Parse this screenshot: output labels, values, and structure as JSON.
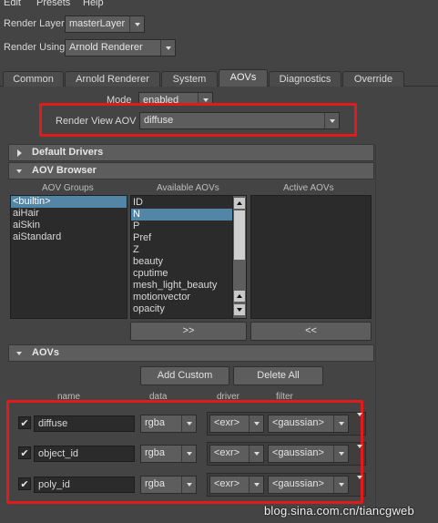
{
  "menu": [
    "Edit",
    "Presets",
    "Help"
  ],
  "render_layer": {
    "label": "Render Layer",
    "value": "masterLayer"
  },
  "render_using": {
    "label": "Render Using",
    "value": "Arnold Renderer"
  },
  "tabs": [
    "Common",
    "Arnold Renderer",
    "System",
    "AOVs",
    "Diagnostics",
    "Override"
  ],
  "active_tab": "AOVs",
  "mode": {
    "label": "Mode",
    "value": "enabled"
  },
  "render_view_aov": {
    "label": "Render View AOV",
    "value": "diffuse"
  },
  "sections": {
    "default_drivers": "Default Drivers",
    "aov_browser": "AOV Browser",
    "aovs": "AOVs"
  },
  "aov_browser": {
    "groups_header": "AOV Groups",
    "available_header": "Available AOVs",
    "active_header": "Active AOVs",
    "groups": [
      "<builtin>",
      "aiHair",
      "aiSkin",
      "aiStandard"
    ],
    "selected_group": "<builtin>",
    "available": [
      "ID",
      "N",
      "P",
      "Pref",
      "Z",
      "beauty",
      "cputime",
      "mesh_light_beauty",
      "motionvector",
      "opacity"
    ],
    "selected_available": "N",
    "add_button": ">>",
    "remove_button": "<<"
  },
  "aovs": {
    "add_custom": "Add Custom",
    "delete_all": "Delete All",
    "columns": {
      "name": "name",
      "data": "data",
      "driver": "driver",
      "filter": "filter"
    },
    "rows": [
      {
        "enabled": "✔",
        "name": "diffuse",
        "data": "rgba",
        "driver": "<exr>",
        "filter": "<gaussian>"
      },
      {
        "enabled": "✔",
        "name": "object_id",
        "data": "rgba",
        "driver": "<exr>",
        "filter": "<gaussian>"
      },
      {
        "enabled": "✔",
        "name": "poly_id",
        "data": "rgba",
        "driver": "<exr>",
        "filter": "<gaussian>"
      }
    ]
  },
  "watermark": "blog.sina.com.cn/tiancgweb",
  "colors": {
    "highlight": "#e21a1a",
    "selection": "#5285a6",
    "background": "#444444"
  }
}
